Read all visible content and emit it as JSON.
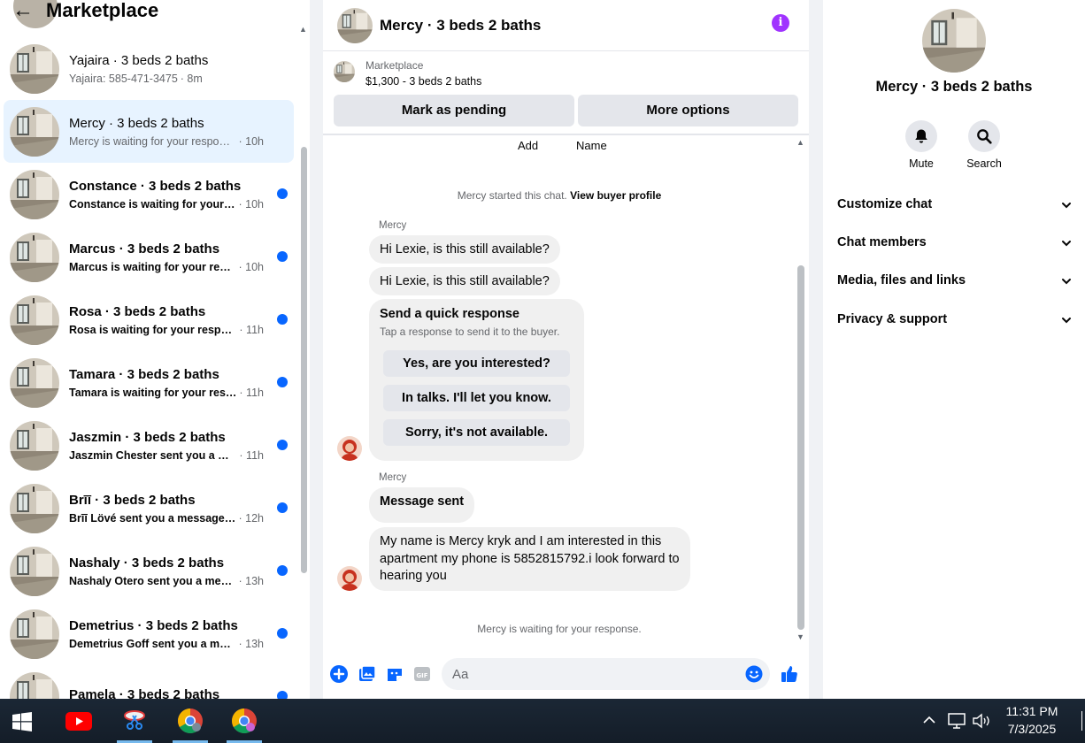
{
  "left": {
    "back_glyph": "←",
    "title": "Marketplace",
    "conversations": [
      {
        "name": "Yajaira · 3 beds 2 baths",
        "preview": "Yajaira: 585-471-3475",
        "time": "· 8m",
        "unread": false
      },
      {
        "name": "Mercy · 3 beds 2 baths",
        "preview": "Mercy is waiting for your response.",
        "time": "· 10h",
        "unread": false,
        "active": true
      },
      {
        "name": "Constance · 3 beds 2 baths",
        "preview": "Constance is waiting for your r...",
        "time": "· 10h",
        "unread": true
      },
      {
        "name": "Marcus · 3 beds 2 baths",
        "preview": "Marcus is waiting for your resp...",
        "time": "· 10h",
        "unread": true
      },
      {
        "name": "Rosa · 3 beds 2 baths",
        "preview": "Rosa is waiting for your respo...",
        "time": "· 11h",
        "unread": true
      },
      {
        "name": "Tamara · 3 beds 2 baths",
        "preview": "Tamara is waiting for your resp...",
        "time": "· 11h",
        "unread": true
      },
      {
        "name": "Jaszmin · 3 beds 2 baths",
        "preview": "Jaszmin Chester sent you a me...",
        "time": "· 11h",
        "unread": true
      },
      {
        "name": "Brīī · 3 beds 2 baths",
        "preview": "Brīī Lövé sent you a message a...",
        "time": "· 12h",
        "unread": true
      },
      {
        "name": "Nashaly · 3 beds 2 baths",
        "preview": "Nashaly Otero sent you a mess...",
        "time": "· 13h",
        "unread": true
      },
      {
        "name": "Demetrius · 3 beds 2 baths",
        "preview": "Demetrius Goff sent you a mes...",
        "time": "· 13h",
        "unread": true
      },
      {
        "name": "Pamela · 3 beds 2 baths",
        "preview": "",
        "time": "",
        "unread": true
      }
    ]
  },
  "chat": {
    "title": "Mercy · 3 beds 2 baths",
    "info_glyph": "i",
    "listing": {
      "source": "Marketplace",
      "price": "$1,300 - 3 beds 2 baths",
      "pending_label": "Mark as pending",
      "more_label": "More options"
    },
    "subtabs": {
      "add": "Add",
      "name": "Name"
    },
    "started_text": "Mercy started this chat.",
    "view_profile": "View buyer profile",
    "sender1": "Mercy",
    "msg1": "Hi Lexie, is this still available?",
    "msg2": "Hi Lexie, is this still available?",
    "quick": {
      "title": "Send a quick response",
      "subtitle": "Tap a response to send it to the buyer.",
      "options": [
        "Yes, are you interested?",
        "In talks. I'll let you know.",
        "Sorry, it's not available."
      ]
    },
    "sender2": "Mercy",
    "msg3": "Message sent",
    "msg4_lines": [
      "My name is Mercy kryk and I am interested in this",
      "apartment my phone is 5852815792.i look forward to",
      "hearing you"
    ],
    "waiting": "Mercy is waiting for your response.",
    "composer_placeholder": "Aa"
  },
  "right": {
    "name": "Mercy · 3 beds 2 baths",
    "mute_label": "Mute",
    "search_label": "Search",
    "sections": [
      "Customize chat",
      "Chat members",
      "Media, files and links",
      "Privacy & support"
    ]
  },
  "taskbar": {
    "time": "11:31 PM",
    "date": "7/3/2025"
  },
  "colors": {
    "accent": "#0866ff",
    "info": "#a033ff",
    "active_row": "#e7f3ff"
  }
}
